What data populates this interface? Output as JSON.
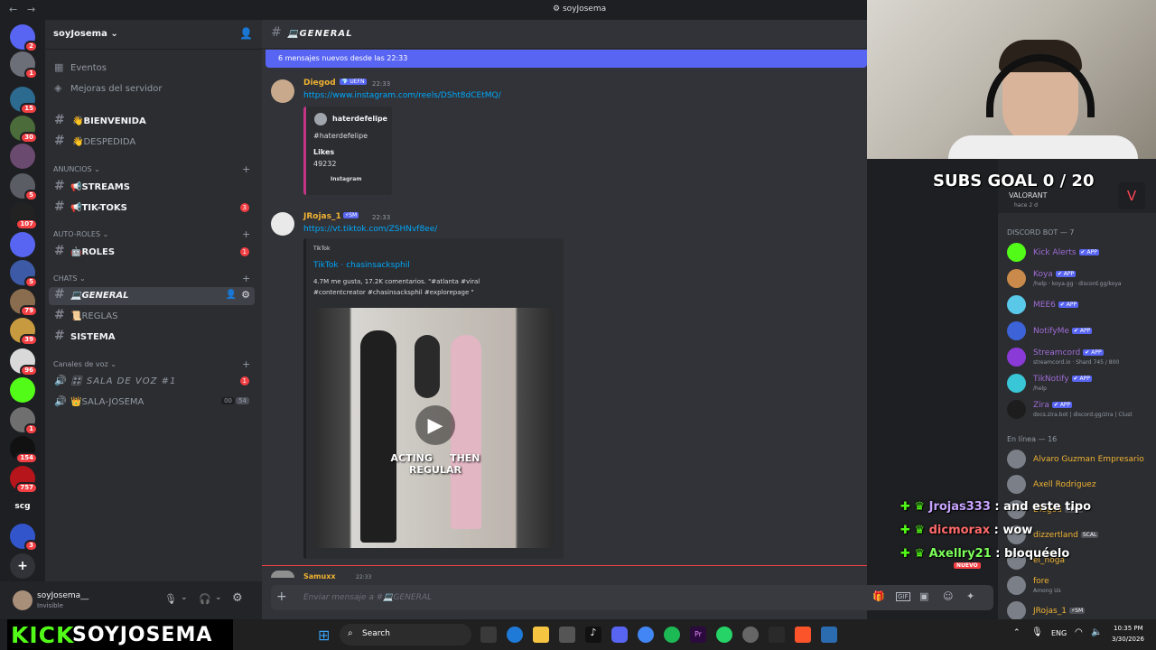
{
  "window": {
    "title": "soyJosema"
  },
  "servers": [
    {
      "label": "",
      "badge": "2",
      "color": "#5865f2"
    },
    {
      "label": "",
      "badge": "1",
      "color": "#6d6f78"
    },
    {
      "label": "",
      "badge": "15",
      "color": "#2d6a8f"
    },
    {
      "label": "",
      "badge": "30",
      "color": "#4b6b3a"
    },
    {
      "label": "",
      "badge": "",
      "color": "#6b4a6f"
    },
    {
      "label": "",
      "badge": "5",
      "color": "#5a5d64"
    },
    {
      "label": "",
      "badge": "107",
      "color": "#222"
    },
    {
      "label": "",
      "badge": "",
      "color": "#5865f2"
    },
    {
      "label": "",
      "badge": "5",
      "color": "#3d5aa6"
    },
    {
      "label": "",
      "badge": "79",
      "color": "#8a6d4e"
    },
    {
      "label": "",
      "badge": "39",
      "color": "#c89a3f"
    },
    {
      "label": "",
      "badge": "96",
      "color": "#d9d9d9"
    },
    {
      "label": "",
      "badge": "",
      "color": "#53fc18"
    },
    {
      "label": "",
      "badge": "1",
      "color": "#6f6f6f"
    },
    {
      "label": "",
      "badge": "154",
      "color": "#111"
    },
    {
      "label": "",
      "badge": "757",
      "color": "#b5151b"
    },
    {
      "label": "scg",
      "badge": "",
      "color": "#1e1f22"
    },
    {
      "label": "",
      "badge": "3",
      "color": "#3355cc"
    }
  ],
  "guild": {
    "name": "soyJosema"
  },
  "top_items": [
    {
      "label": "Eventos"
    },
    {
      "label": "Mejoras del servidor"
    }
  ],
  "channels": {
    "bienvenida": "👋BIENVENIDA",
    "despedida": "👋DESPEDIDA",
    "cat_anuncios": "ANUNCIOS",
    "streams": "📢STREAMS",
    "tiktoks": "📢TIK-TOKS",
    "tiktoks_count": "3",
    "cat_autoroles": "AUTO-ROLES",
    "roles": "🤖ROLES",
    "roles_count": "1",
    "cat_chats": "CHATS",
    "general": "💻GENERAL",
    "reglas": "📜REGLAS",
    "sistema": "SISTEMA",
    "cat_voz": "Canales de voz",
    "sala_voz": "🎛 SALA DE VOZ #1",
    "sala_voz_count": "1",
    "sala_josema": "👑SALA-JOSEMA",
    "sala_josema_a": "00",
    "sala_josema_b": "54"
  },
  "user": {
    "name": "soyJosema__",
    "status": "Invisible"
  },
  "chat": {
    "channel_title": "💻GENERAL",
    "banner": "6 mensajes nuevos desde las 22:33",
    "input_placeholder": "Enviar mensaje a #💻GENERAL",
    "messages": [
      {
        "author": "Diegod",
        "tag": "💎 UEFN",
        "time": "22:33",
        "link": "https://www.instagram.com/reels/DSht8dCEtMQ/",
        "embed": {
          "title": "haterdefelipe",
          "desc": "#haterdefelipe",
          "field_name": "Likes",
          "field_value": "49232",
          "footer": "Instagram"
        }
      },
      {
        "author": "JRojas_1",
        "tag": "⚡SM",
        "time": "22:33",
        "link": "https://vt.tiktok.com/ZSHNvf8ee/",
        "embed": {
          "provider": "TikTok",
          "title": "TikTok · chasinsacksphil",
          "desc1": "4.7M me gusta, 17.2K comentarios. \"#atlanta #viral",
          "desc2": "#contentcreator #chasinsacksphil #explorepage \"",
          "video_caption": "ACTING     THEN\nREGULAR"
        }
      },
      {
        "author": "Samuxx",
        "tag": "",
        "time": "22:33"
      }
    ]
  },
  "members": {
    "stream_game": "VALORANT",
    "stream_time": "hace 2 d",
    "bot_category": "DISCORD BOT — 7",
    "bots": [
      {
        "name": "Kick Alerts",
        "sub": "",
        "app": "✔ APP",
        "color": "#53fc18"
      },
      {
        "name": "Koya",
        "sub": "/help · koya.gg · discord.gg/koya",
        "app": "✔ APP",
        "color": "#c98a4b"
      },
      {
        "name": "MEE6",
        "sub": "",
        "app": "✔ APP",
        "color": "#5ac8e8"
      },
      {
        "name": "NotifyMe",
        "sub": "",
        "app": "✔ APP",
        "color": "#3d63d8"
      },
      {
        "name": "Streamcord",
        "sub": "streamcord.io · Shard 745 / 800",
        "app": "✔ APP",
        "color": "#8a3ad6"
      },
      {
        "name": "TikNotify",
        "sub": "/help",
        "app": "✔ APP",
        "color": "#39c6d6"
      },
      {
        "name": "Zira",
        "sub": "docs.zira.bot | discord.gg/zira | Clust",
        "app": "✔ APP",
        "color": "#1d1d1d"
      }
    ],
    "online_category": "En línea — 16",
    "online": [
      {
        "name": "Alvaro Guzman Empresario",
        "sub": "",
        "tag": "",
        "color": "#f0b232"
      },
      {
        "name": "Axell Rodriguez",
        "sub": "",
        "tag": "",
        "color": "#f0b232"
      },
      {
        "name": "Diegod",
        "sub": "",
        "tag": "UEFN",
        "color": "#f0b232"
      },
      {
        "name": "dizzertland",
        "sub": "",
        "tag": "SCAL",
        "color": "#f0b232"
      },
      {
        "name": "el_noga",
        "sub": "",
        "tag": "",
        "color": "#f0b232"
      },
      {
        "name": "fore",
        "sub": "Among Us",
        "tag": "",
        "color": "#f0b232"
      },
      {
        "name": "JRojas_1",
        "sub": "",
        "tag": "⚡SM",
        "color": "#f0b232"
      }
    ]
  },
  "overlay": {
    "subs_goal": "SUBS GOAL 0 / 20",
    "chat": [
      {
        "user": "Jrojas333",
        "msg": "and este tipo",
        "color": "#c7a4ff"
      },
      {
        "user": "dicmorax",
        "msg": "wow",
        "color": "#ff6b6b"
      },
      {
        "user": "Axellry21",
        "msg": "bloquéelo",
        "color": "#7cff5a"
      }
    ],
    "nuevo": "NUEVO",
    "brand_kick": "KICK",
    "brand_name": "SOYJOSEMA"
  },
  "taskbar": {
    "search": "Search",
    "lang": "ENG",
    "time": "10:35 PM",
    "date": "3/30/2026"
  }
}
